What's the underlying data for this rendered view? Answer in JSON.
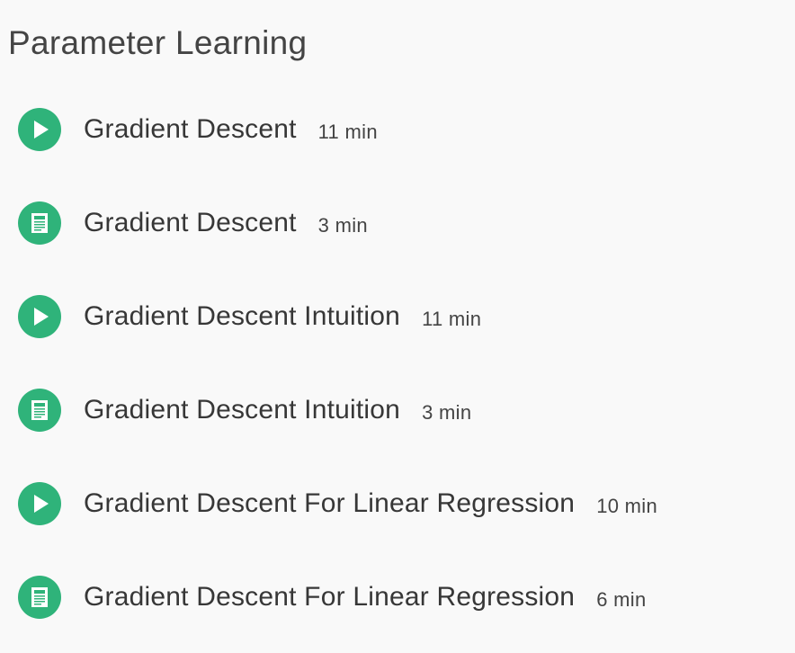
{
  "section": {
    "title": "Parameter Learning"
  },
  "accent_color": "#2fb37a",
  "items": [
    {
      "type": "video",
      "icon": "play-icon",
      "title": "Gradient Descent",
      "duration": "11 min"
    },
    {
      "type": "reading",
      "icon": "document-icon",
      "title": "Gradient Descent",
      "duration": "3 min"
    },
    {
      "type": "video",
      "icon": "play-icon",
      "title": "Gradient Descent Intuition",
      "duration": "11 min"
    },
    {
      "type": "reading",
      "icon": "document-icon",
      "title": "Gradient Descent Intuition",
      "duration": "3 min"
    },
    {
      "type": "video",
      "icon": "play-icon",
      "title": "Gradient Descent For Linear Regression",
      "duration": "10 min"
    },
    {
      "type": "reading",
      "icon": "document-icon",
      "title": "Gradient Descent For Linear Regression",
      "duration": "6 min"
    }
  ]
}
